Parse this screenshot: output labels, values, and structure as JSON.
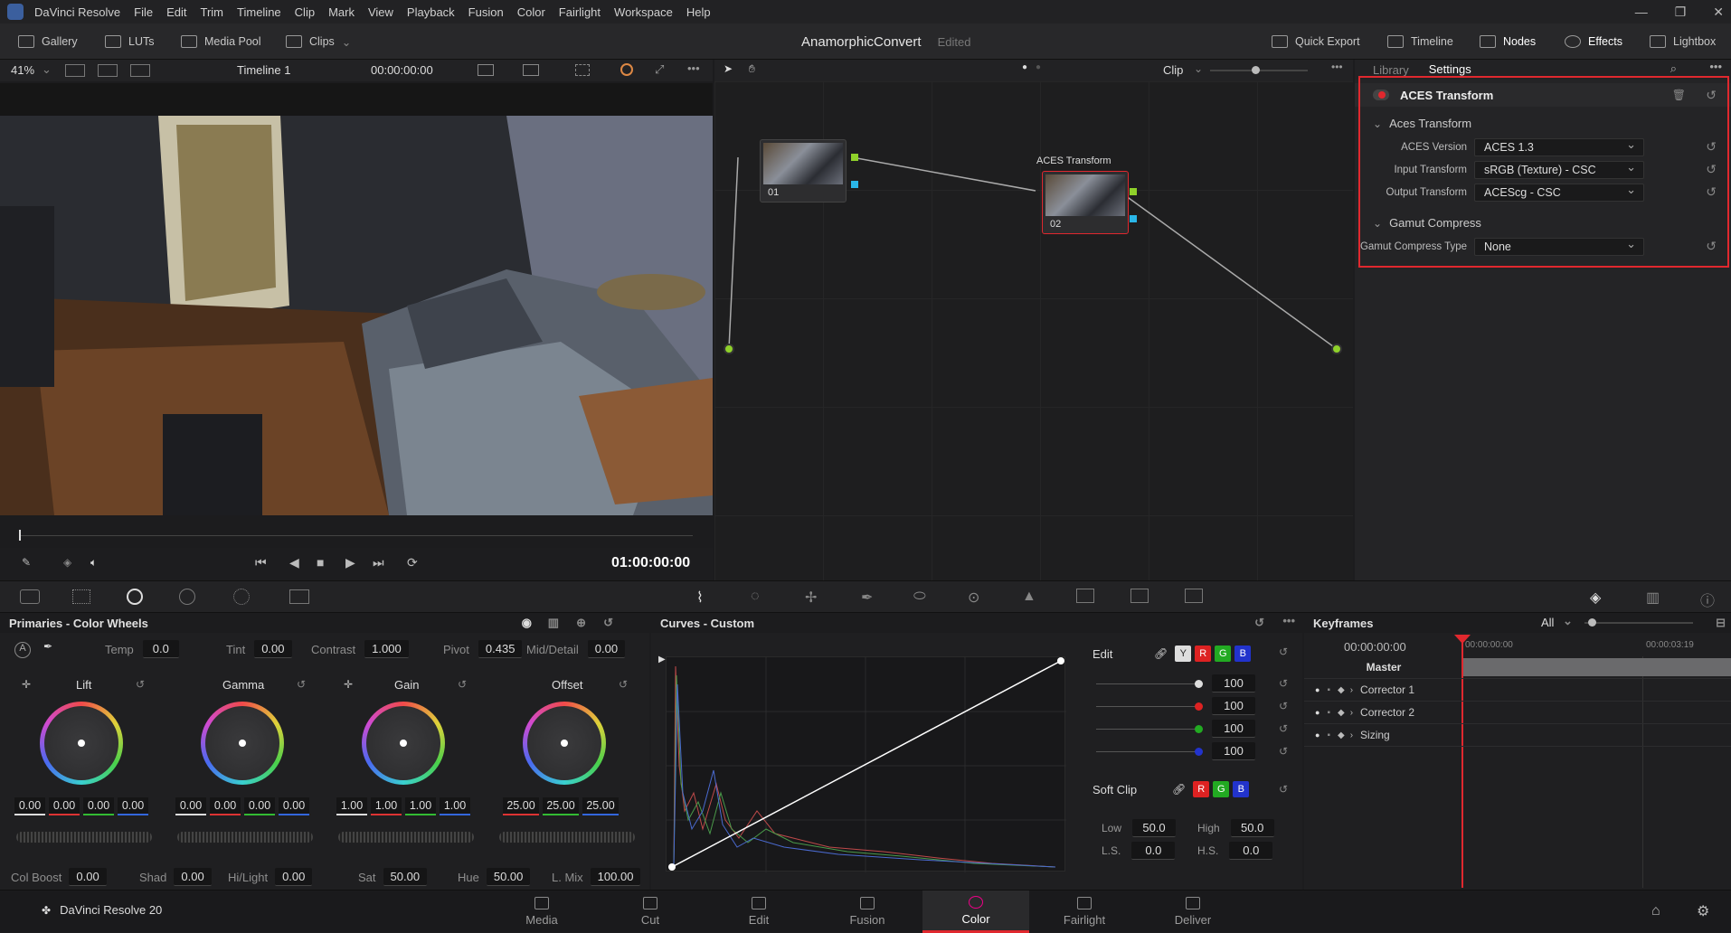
{
  "menubar": {
    "app_name": "DaVinci Resolve",
    "items": [
      "File",
      "Edit",
      "Trim",
      "Timeline",
      "Clip",
      "Mark",
      "View",
      "Playback",
      "Fusion",
      "Color",
      "Fairlight",
      "Workspace",
      "Help"
    ]
  },
  "toolbar": {
    "gallery": "Gallery",
    "luts": "LUTs",
    "media_pool": "Media Pool",
    "clips": "Clips",
    "project_title": "AnamorphicConvert",
    "project_status": "Edited",
    "quick_export": "Quick Export",
    "timeline": "Timeline",
    "nodes": "Nodes",
    "effects": "Effects",
    "lightbox": "Lightbox"
  },
  "viewer": {
    "zoom": "41%",
    "timeline_name": "Timeline 1",
    "source_tc": "00:00:00:00",
    "timecode": "01:00:00:00"
  },
  "node_editor": {
    "mode": "Clip",
    "node1_label": "01",
    "node2_label": "02",
    "node2_title": "ACES Transform"
  },
  "settings": {
    "tab_library": "Library",
    "tab_settings": "Settings",
    "effect_name": "ACES Transform",
    "section_aces": "Aces Transform",
    "aces_version_label": "ACES Version",
    "aces_version_value": "ACES 1.3",
    "input_transform_label": "Input Transform",
    "input_transform_value": "sRGB (Texture) - CSC",
    "output_transform_label": "Output Transform",
    "output_transform_value": "ACEScg - CSC",
    "section_gamut": "Gamut Compress",
    "gamut_type_label": "Gamut Compress Type",
    "gamut_type_value": "None"
  },
  "primaries": {
    "title": "Primaries - Color Wheels",
    "temp_label": "Temp",
    "temp": "0.0",
    "tint_label": "Tint",
    "tint": "0.00",
    "contrast_label": "Contrast",
    "contrast": "1.000",
    "pivot_label": "Pivot",
    "pivot": "0.435",
    "middetail_label": "Mid/Detail",
    "middetail": "0.00",
    "wheels": [
      {
        "name": "Lift",
        "values": [
          "0.00",
          "0.00",
          "0.00",
          "0.00"
        ]
      },
      {
        "name": "Gamma",
        "values": [
          "0.00",
          "0.00",
          "0.00",
          "0.00"
        ]
      },
      {
        "name": "Gain",
        "values": [
          "1.00",
          "1.00",
          "1.00",
          "1.00"
        ]
      },
      {
        "name": "Offset",
        "values": [
          "25.00",
          "25.00",
          "25.00"
        ]
      }
    ],
    "colboost_label": "Col Boost",
    "colboost": "0.00",
    "shad_label": "Shad",
    "shad": "0.00",
    "hilight_label": "Hi/Light",
    "hilight": "0.00",
    "sat_label": "Sat",
    "sat": "50.00",
    "hue_label": "Hue",
    "hue": "50.00",
    "lmix_label": "L. Mix",
    "lmix": "100.00"
  },
  "curves": {
    "title": "Curves - Custom",
    "edit_label": "Edit",
    "chan_y": "Y",
    "chan_r": "R",
    "chan_g": "G",
    "chan_b": "B",
    "intensity": [
      "100",
      "100",
      "100",
      "100"
    ],
    "softclip_label": "Soft Clip",
    "low_label": "Low",
    "low": "50.0",
    "high_label": "High",
    "high": "50.0",
    "ls_label": "L.S.",
    "ls": "0.0",
    "hs_label": "H.S.",
    "hs": "0.0"
  },
  "keyframes": {
    "title": "Keyframes",
    "filter": "All",
    "timecode": "00:00:00:00",
    "ruler_start": "00:00:00:00",
    "ruler_end": "00:00:03:19",
    "rows": [
      "Master",
      "Corrector 1",
      "Corrector 2",
      "Sizing"
    ]
  },
  "bottomnav": {
    "app": "DaVinci Resolve 20",
    "pages": [
      "Media",
      "Cut",
      "Edit",
      "Fusion",
      "Color",
      "Fairlight",
      "Deliver"
    ],
    "active": "Color"
  }
}
